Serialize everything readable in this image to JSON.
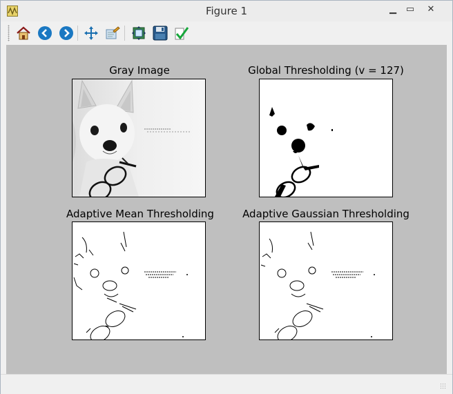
{
  "window": {
    "title": "Figure 1",
    "controls": {
      "minimize": "▁",
      "maximize": "▭",
      "close": "✕"
    }
  },
  "toolbar": {
    "items": [
      {
        "name": "home-icon",
        "tooltip": "Home"
      },
      {
        "name": "back-icon",
        "tooltip": "Back"
      },
      {
        "name": "forward-icon",
        "tooltip": "Forward"
      },
      {
        "name": "pan-icon",
        "tooltip": "Pan"
      },
      {
        "name": "zoom-icon",
        "tooltip": "Zoom"
      },
      {
        "name": "subplots-icon",
        "tooltip": "Subplots"
      },
      {
        "name": "save-icon",
        "tooltip": "Save"
      },
      {
        "name": "edit-icon",
        "tooltip": "Customize"
      }
    ]
  },
  "figure": {
    "subplots": [
      {
        "title": "Gray Image"
      },
      {
        "title": "Global Thresholding (v = 127)"
      },
      {
        "title": "Adaptive Mean Thresholding"
      },
      {
        "title": "Adaptive Gaussian Thresholding"
      }
    ],
    "background_color": "#bfbfbf"
  }
}
